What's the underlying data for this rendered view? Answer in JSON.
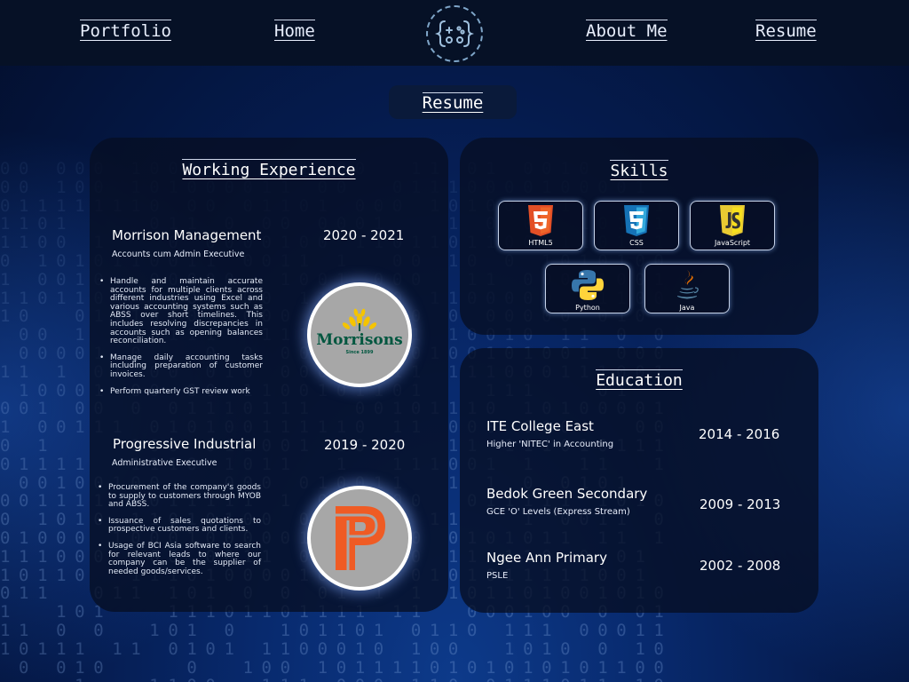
{
  "nav": {
    "links": [
      "Portfolio",
      "Home",
      "About Me",
      "Resume"
    ],
    "logo_icon": "gamepad-icon"
  },
  "page": {
    "title": "Resume"
  },
  "experience": {
    "title": "Working Experience",
    "jobs": [
      {
        "company": "Morrison Management",
        "role": "Accounts cum Admin Executive",
        "years": "2020 - 2021",
        "logo": "morrisons-logo",
        "logo_text": "Morrisons",
        "logo_subtext": "Since 1899",
        "duties": [
          "Handle and maintain accurate accounts for multiple clients across different industries using Excel and various accounting systems such as ABSS over short timelines. This includes resolving discrepancies in accounts such as opening balances reconciliation.",
          "Manage daily accounting tasks including preparation of customer invoices.",
          "Perform quarterly GST review work"
        ]
      },
      {
        "company": "Progressive Industrial",
        "role": "Administrative Executive",
        "years": "2019 - 2020",
        "logo": "progressive-logo",
        "duties": [
          "Procurement of the company's goods to supply to customers through MYOB and ABSS.",
          "Issuance of sales quotations to prospective customers and clients.",
          "Usage of BCI Asia software to search for relevant leads to where our company can be the supplier of needed goods/services."
        ]
      }
    ]
  },
  "skills": {
    "title": "Skills",
    "items": [
      {
        "label": "HTML5",
        "icon": "html5-icon"
      },
      {
        "label": "CSS",
        "icon": "css3-icon"
      },
      {
        "label": "JavaScript",
        "icon": "javascript-icon"
      },
      {
        "label": "Python",
        "icon": "python-icon"
      },
      {
        "label": "Java",
        "icon": "java-icon"
      }
    ]
  },
  "education": {
    "title": "Education",
    "items": [
      {
        "school": "ITE College East",
        "qualification": "Higher 'NITEC' in Accounting",
        "years": "2014 - 2016"
      },
      {
        "school": "Bedok Green Secondary",
        "qualification": "GCE 'O' Levels (Express Stream)",
        "years": "2009 - 2013"
      },
      {
        "school": "Ngee Ann Primary",
        "qualification": "PSLE",
        "years": "2002 - 2008"
      }
    ]
  },
  "colors": {
    "background": "#051b4d",
    "navbar": "#061126",
    "panel": "#060e23",
    "text": "#ffffff",
    "progressive_orange": "#ef5b24",
    "morrisons_green": "#00563f",
    "morrisons_yellow": "#f5c400"
  }
}
